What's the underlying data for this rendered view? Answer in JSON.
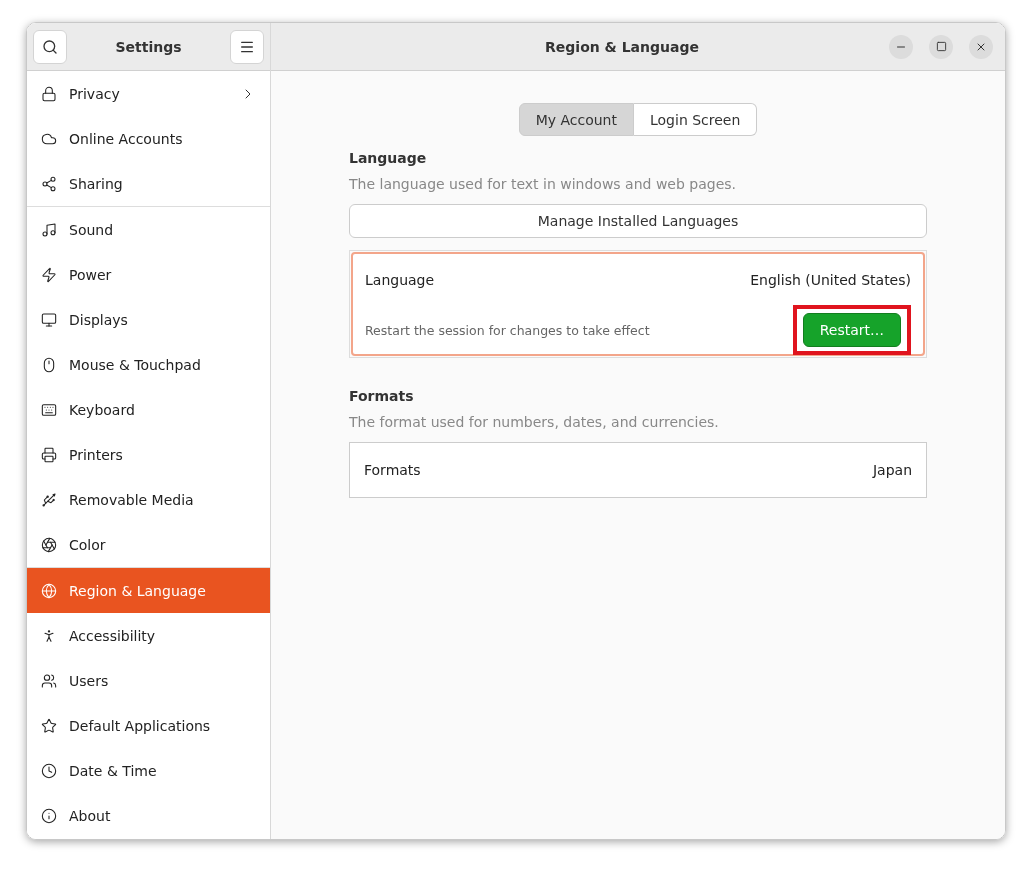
{
  "sidebar": {
    "title": "Settings",
    "groups": [
      [
        {
          "label": "Privacy",
          "selected": false,
          "submenu": true
        },
        {
          "label": "Online Accounts",
          "selected": false,
          "submenu": false
        },
        {
          "label": "Sharing",
          "selected": false,
          "submenu": false
        }
      ],
      [
        {
          "label": "Sound",
          "selected": false,
          "submenu": false
        },
        {
          "label": "Power",
          "selected": false,
          "submenu": false
        },
        {
          "label": "Displays",
          "selected": false,
          "submenu": false
        },
        {
          "label": "Mouse & Touchpad",
          "selected": false,
          "submenu": false
        },
        {
          "label": "Keyboard",
          "selected": false,
          "submenu": false
        },
        {
          "label": "Printers",
          "selected": false,
          "submenu": false
        },
        {
          "label": "Removable Media",
          "selected": false,
          "submenu": false
        },
        {
          "label": "Color",
          "selected": false,
          "submenu": false
        }
      ],
      [
        {
          "label": "Region & Language",
          "selected": true,
          "submenu": false
        },
        {
          "label": "Accessibility",
          "selected": false,
          "submenu": false
        },
        {
          "label": "Users",
          "selected": false,
          "submenu": false
        },
        {
          "label": "Default Applications",
          "selected": false,
          "submenu": false
        },
        {
          "label": "Date & Time",
          "selected": false,
          "submenu": false
        },
        {
          "label": "About",
          "selected": false,
          "submenu": false
        }
      ]
    ]
  },
  "window": {
    "title": "Region & Language"
  },
  "tabs": [
    {
      "label": "My Account",
      "selected": true
    },
    {
      "label": "Login Screen",
      "selected": false
    }
  ],
  "language": {
    "heading": "Language",
    "description": "The language used for text in windows and web pages.",
    "manage_button": "Manage Installed Languages",
    "row_label": "Language",
    "row_value": "English (United States)",
    "notice": "Restart the session for changes to take effect",
    "restart_button": "Restart…",
    "highlighted": true
  },
  "formats": {
    "heading": "Formats",
    "description": "The format used for numbers, dates, and currencies.",
    "row_label": "Formats",
    "row_value": "Japan"
  }
}
